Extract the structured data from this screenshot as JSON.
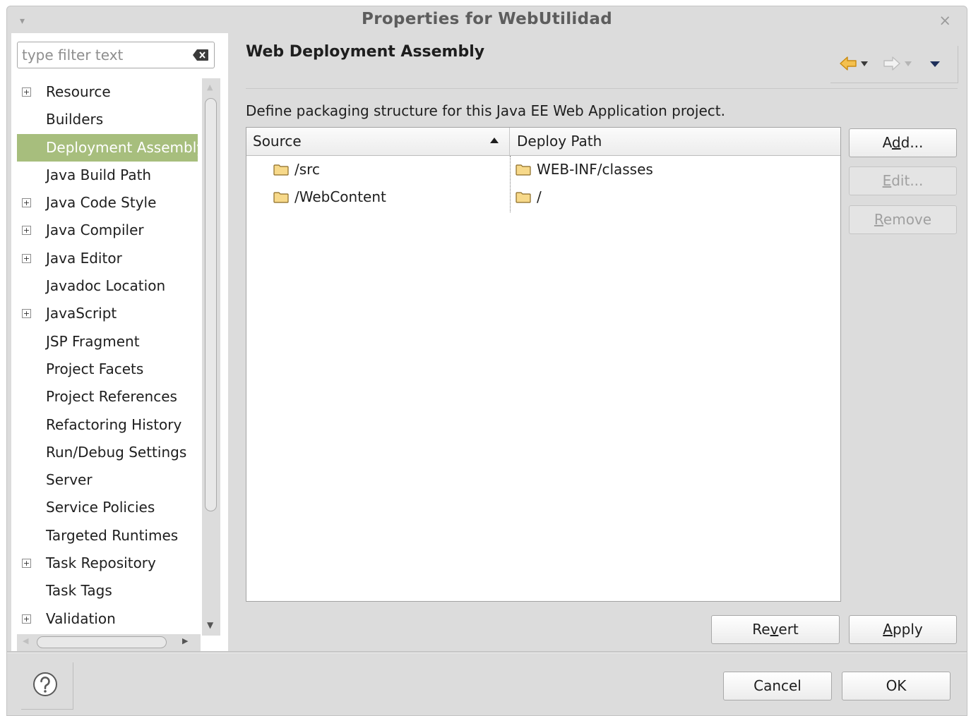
{
  "window": {
    "title": "Properties for WebUtilidad",
    "close_glyph": "×",
    "menu_glyph": "▾"
  },
  "filter": {
    "placeholder": "type filter text",
    "value": ""
  },
  "tree": {
    "items": [
      {
        "label": "Resource",
        "expandable": true,
        "selected": false
      },
      {
        "label": "Builders",
        "expandable": false,
        "selected": false
      },
      {
        "label": "Deployment Assembly",
        "expandable": false,
        "selected": true
      },
      {
        "label": "Java Build Path",
        "expandable": false,
        "selected": false
      },
      {
        "label": "Java Code Style",
        "expandable": true,
        "selected": false
      },
      {
        "label": "Java Compiler",
        "expandable": true,
        "selected": false
      },
      {
        "label": "Java Editor",
        "expandable": true,
        "selected": false
      },
      {
        "label": "Javadoc Location",
        "expandable": false,
        "selected": false
      },
      {
        "label": "JavaScript",
        "expandable": true,
        "selected": false
      },
      {
        "label": "JSP Fragment",
        "expandable": false,
        "selected": false
      },
      {
        "label": "Project Facets",
        "expandable": false,
        "selected": false
      },
      {
        "label": "Project References",
        "expandable": false,
        "selected": false
      },
      {
        "label": "Refactoring History",
        "expandable": false,
        "selected": false
      },
      {
        "label": "Run/Debug Settings",
        "expandable": false,
        "selected": false
      },
      {
        "label": "Server",
        "expandable": false,
        "selected": false
      },
      {
        "label": "Service Policies",
        "expandable": false,
        "selected": false
      },
      {
        "label": "Targeted Runtimes",
        "expandable": false,
        "selected": false
      },
      {
        "label": "Task Repository",
        "expandable": true,
        "selected": false
      },
      {
        "label": "Task Tags",
        "expandable": false,
        "selected": false
      },
      {
        "label": "Validation",
        "expandable": true,
        "selected": false
      }
    ]
  },
  "page": {
    "title": "Web Deployment Assembly",
    "description": "Define packaging structure for this Java EE Web Application project."
  },
  "table": {
    "columns": [
      "Source",
      "Deploy Path"
    ],
    "sort_column": "Source",
    "sort_direction": "ascending",
    "rows": [
      {
        "source": "/src",
        "deploy_path": "WEB-INF/classes"
      },
      {
        "source": "/WebContent",
        "deploy_path": "/"
      }
    ]
  },
  "buttons": {
    "add": {
      "pre": "A",
      "mnemonic": "d",
      "post": "d...",
      "enabled": true
    },
    "edit": {
      "pre": "",
      "mnemonic": "E",
      "post": "dit...",
      "enabled": false
    },
    "remove": {
      "pre": "",
      "mnemonic": "R",
      "post": "emove",
      "enabled": false
    },
    "revert": {
      "pre": "Re",
      "mnemonic": "v",
      "post": "ert",
      "enabled": true
    },
    "apply": {
      "pre": "",
      "mnemonic": "A",
      "post": "pply",
      "enabled": true
    },
    "cancel": {
      "label": "Cancel"
    },
    "ok": {
      "label": "OK"
    }
  },
  "icons": {
    "help": "help-icon",
    "folder": "folder-icon",
    "back": "back-arrow-icon",
    "forward": "forward-arrow-icon",
    "clear": "clear-text-icon"
  },
  "colors": {
    "selection": "#a7be7d",
    "dialog_background": "#dcdcdc",
    "folder": "#f1c35a",
    "back_arrow": "#e8a827"
  }
}
